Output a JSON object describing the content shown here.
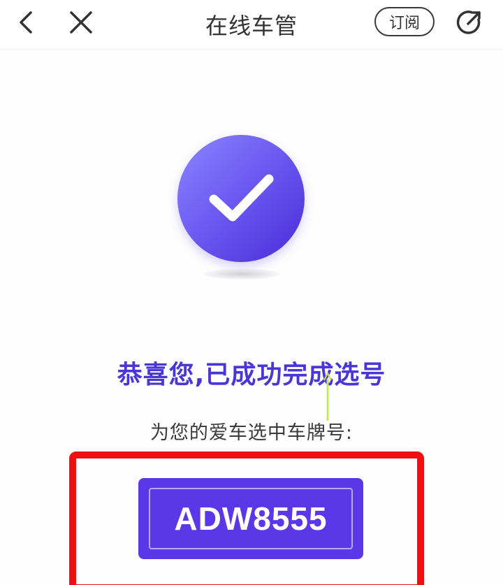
{
  "navbar": {
    "title": "在线车管",
    "subscribe_label": "订阅",
    "back_icon": "chevron-left-icon",
    "close_icon": "close-icon",
    "share_icon": "share-icon"
  },
  "result": {
    "icon": "check-circle-icon",
    "title": "恭喜您,已成功完成选号",
    "caption": "为您的爱车选中车牌号:",
    "plate_number": "ADW8555"
  },
  "colors": {
    "accent": "#5b37e8",
    "title_text": "#4a36d6",
    "highlight": "#ee1111"
  }
}
